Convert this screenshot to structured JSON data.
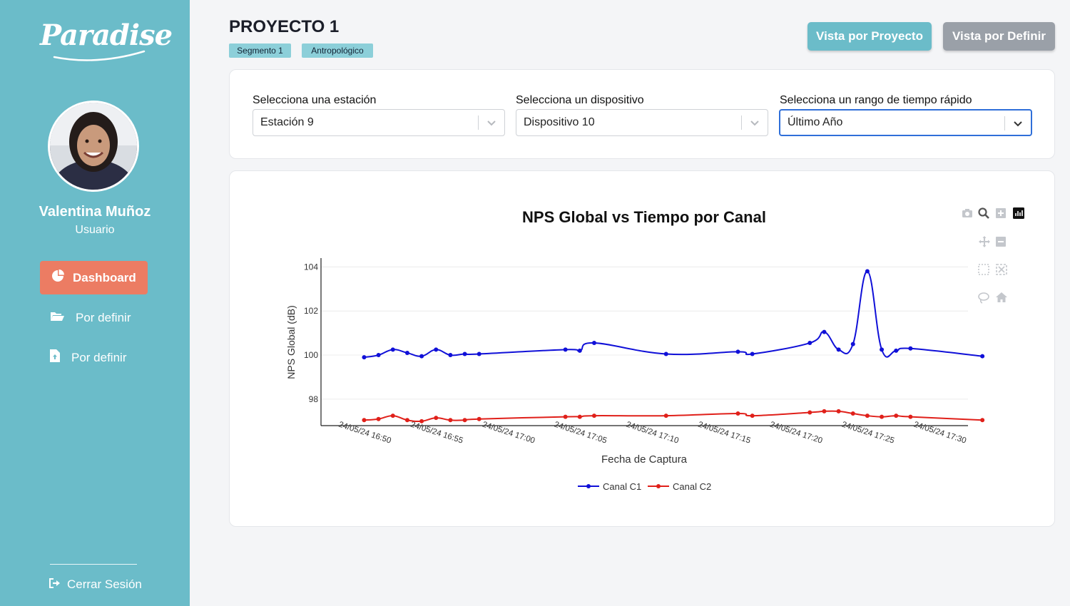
{
  "sidebar": {
    "logo_text": "Paradise",
    "user_name": "Valentina Muñoz",
    "user_role": "Usuario",
    "nav": [
      {
        "label": "Dashboard",
        "icon": "pie-chart-icon",
        "active": true
      },
      {
        "label": "Por definir",
        "icon": "folder-open-icon",
        "active": false
      },
      {
        "label": "Por definir",
        "icon": "file-upload-icon",
        "active": false
      }
    ],
    "logout_label": "Cerrar Sesión"
  },
  "header": {
    "title": "PROYECTO 1",
    "tags": [
      "Segmento 1",
      "Antropológico"
    ],
    "buttons": [
      {
        "label": "Vista por Proyecto",
        "color": "#6bbcc9"
      },
      {
        "label": "Vista por Definir",
        "color": "#9aa0a8"
      }
    ]
  },
  "filters": [
    {
      "label": "Selecciona una estación",
      "value": "Estación 9"
    },
    {
      "label": "Selecciona un dispositivo",
      "value": "Dispositivo 10"
    },
    {
      "label": "Selecciona un rango de tiempo rápido",
      "value": "Último Año"
    }
  ],
  "colors": {
    "sidebar": "#6bbcc9",
    "accent": "#ec7c63",
    "series_c1": "#1010d8",
    "series_c2": "#e0201a"
  },
  "chart_data": {
    "type": "line",
    "title": "NPS Global vs Tiempo por Canal",
    "xlabel": "Fecha de Captura",
    "ylabel": "NPS Global (dB)",
    "x_unit": "minutes",
    "x_ticks": [
      {
        "value": "16:50",
        "label": "24/05/24 16:50"
      },
      {
        "value": "16:55",
        "label": "24/05/24 16:55"
      },
      {
        "value": "17:00",
        "label": "24/05/24 17:00"
      },
      {
        "value": "17:05",
        "label": "24/05/24 17:05"
      },
      {
        "value": "17:10",
        "label": "24/05/24 17:10"
      },
      {
        "value": "17:15",
        "label": "24/05/24 17:15"
      },
      {
        "value": "17:20",
        "label": "24/05/24 17:20"
      },
      {
        "value": "17:25",
        "label": "24/05/24 17:25"
      },
      {
        "value": "17:30",
        "label": "24/05/24 17:30"
      }
    ],
    "y_ticks": [
      98,
      100,
      102,
      104
    ],
    "xlim": [
      "16:47",
      "17:32"
    ],
    "ylim": [
      96.8,
      104.4
    ],
    "grid": true,
    "legend_position": "bottom-center",
    "series": [
      {
        "name": "Canal C1",
        "color": "#1010d8",
        "x": [
          "16:50",
          "16:51",
          "16:52",
          "16:53",
          "16:54",
          "16:55",
          "16:56",
          "16:57",
          "16:58",
          "17:04",
          "17:05",
          "17:06",
          "17:11",
          "17:16",
          "17:17",
          "17:21",
          "17:22",
          "17:23",
          "17:24",
          "17:25",
          "17:26",
          "17:27",
          "17:28",
          "17:33"
        ],
        "y": [
          99.9,
          100.0,
          100.25,
          100.1,
          99.95,
          100.25,
          100.0,
          100.05,
          100.05,
          100.25,
          100.2,
          100.55,
          100.05,
          100.15,
          100.05,
          100.55,
          101.05,
          100.25,
          100.5,
          103.8,
          100.25,
          100.2,
          100.3,
          99.95
        ]
      },
      {
        "name": "Canal C2",
        "color": "#e0201a",
        "x": [
          "16:50",
          "16:51",
          "16:52",
          "16:53",
          "16:54",
          "16:55",
          "16:56",
          "16:57",
          "16:58",
          "17:04",
          "17:05",
          "17:06",
          "17:11",
          "17:16",
          "17:17",
          "17:21",
          "17:22",
          "17:23",
          "17:24",
          "17:25",
          "17:26",
          "17:27",
          "17:28",
          "17:33"
        ],
        "y": [
          97.05,
          97.1,
          97.25,
          97.05,
          97.0,
          97.15,
          97.05,
          97.05,
          97.1,
          97.2,
          97.2,
          97.25,
          97.25,
          97.35,
          97.25,
          97.4,
          97.45,
          97.45,
          97.35,
          97.25,
          97.2,
          97.25,
          97.2,
          97.05
        ]
      }
    ]
  }
}
